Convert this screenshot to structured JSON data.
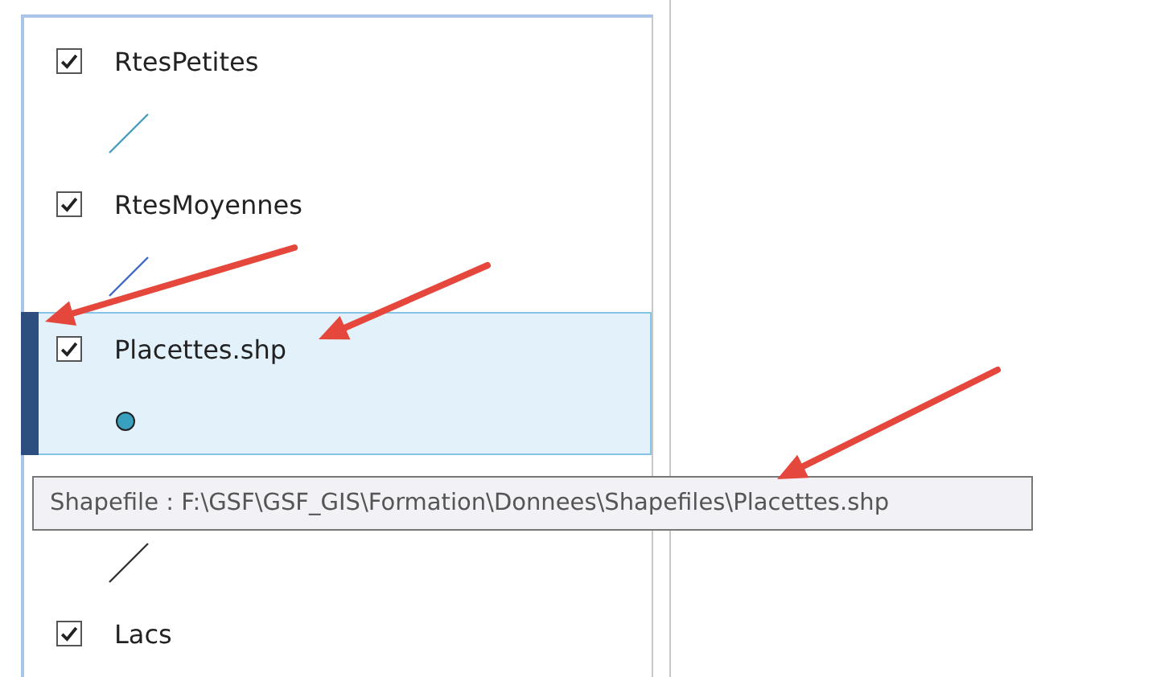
{
  "layers": [
    {
      "name": "RtesPetites",
      "checked": true,
      "selected": false,
      "symbol": {
        "kind": "line",
        "color": "#4a9cc0"
      }
    },
    {
      "name": "RtesMoyennes",
      "checked": true,
      "selected": false,
      "symbol": {
        "kind": "line",
        "color": "#3f66c8"
      }
    },
    {
      "name": "Placettes.shp",
      "checked": true,
      "selected": true,
      "symbol": {
        "kind": "point",
        "color": "#3aa0c0"
      }
    },
    {
      "symbol": {
        "kind": "line",
        "color": "#333333"
      }
    },
    {
      "name": "Lacs",
      "checked": true,
      "selected": false
    }
  ],
  "tooltip": {
    "text": "Shapefile : F:\\GSF\\GSF_GIS\\Formation\\Donnees\\Shapefiles\\Placettes.shp"
  },
  "annotations": [
    {
      "kind": "arrow"
    },
    {
      "kind": "arrow"
    },
    {
      "kind": "arrow"
    }
  ]
}
